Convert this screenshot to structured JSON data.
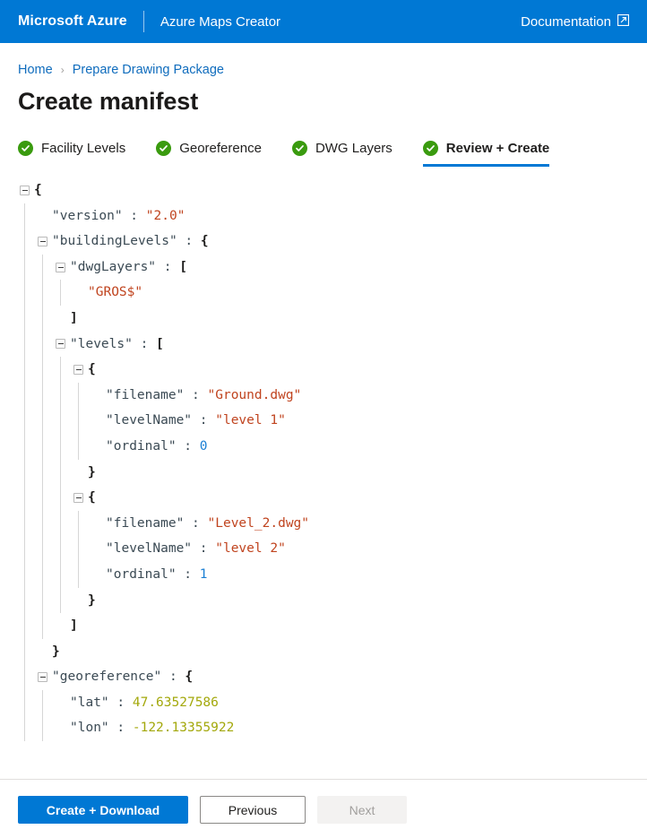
{
  "header": {
    "brand": "Microsoft Azure",
    "app_name": "Azure Maps Creator",
    "documentation_label": "Documentation",
    "external_link_icon": "external-link-icon",
    "background_color": "#0078d4"
  },
  "breadcrumb": {
    "items": [
      {
        "label": "Home"
      },
      {
        "label": "Prepare Drawing Package"
      }
    ],
    "separator": "›",
    "link_color": "#0f6cbd"
  },
  "page": {
    "title": "Create manifest"
  },
  "steps": {
    "items": [
      {
        "label": "Facility Levels",
        "completed": true,
        "active": false
      },
      {
        "label": "Georeference",
        "completed": true,
        "active": false
      },
      {
        "label": "DWG Layers",
        "completed": true,
        "active": false
      },
      {
        "label": "Review + Create",
        "completed": true,
        "active": true
      }
    ],
    "check_icon": "check-circle-icon",
    "check_color": "#3a9b0f",
    "active_underline_color": "#0078d4"
  },
  "manifest": {
    "lines": [
      {
        "indent": 0,
        "toggle": true,
        "tokens": [
          {
            "t": "brace",
            "v": "{"
          }
        ]
      },
      {
        "indent": 1,
        "toggle": false,
        "tokens": [
          {
            "t": "key",
            "v": "\"version\""
          },
          {
            "t": "punct",
            "v": " : "
          },
          {
            "t": "string",
            "v": "\"2.0\""
          }
        ]
      },
      {
        "indent": 1,
        "toggle": true,
        "tokens": [
          {
            "t": "key",
            "v": "\"buildingLevels\""
          },
          {
            "t": "punct",
            "v": " : "
          },
          {
            "t": "brace",
            "v": "{"
          }
        ]
      },
      {
        "indent": 2,
        "toggle": true,
        "tokens": [
          {
            "t": "key",
            "v": "\"dwgLayers\""
          },
          {
            "t": "punct",
            "v": " : "
          },
          {
            "t": "brace",
            "v": "["
          }
        ]
      },
      {
        "indent": 3,
        "toggle": false,
        "tokens": [
          {
            "t": "string",
            "v": "\"GROS$\""
          }
        ]
      },
      {
        "indent": 2,
        "toggle": false,
        "tokens": [
          {
            "t": "brace",
            "v": "]"
          }
        ]
      },
      {
        "indent": 2,
        "toggle": true,
        "tokens": [
          {
            "t": "key",
            "v": "\"levels\""
          },
          {
            "t": "punct",
            "v": " : "
          },
          {
            "t": "brace",
            "v": "["
          }
        ]
      },
      {
        "indent": 3,
        "toggle": true,
        "tokens": [
          {
            "t": "brace",
            "v": "{"
          }
        ]
      },
      {
        "indent": 4,
        "toggle": false,
        "tokens": [
          {
            "t": "key",
            "v": "\"filename\""
          },
          {
            "t": "punct",
            "v": " : "
          },
          {
            "t": "string",
            "v": "\"Ground.dwg\""
          }
        ]
      },
      {
        "indent": 4,
        "toggle": false,
        "tokens": [
          {
            "t": "key",
            "v": "\"levelName\""
          },
          {
            "t": "punct",
            "v": " : "
          },
          {
            "t": "string",
            "v": "\"level 1\""
          }
        ]
      },
      {
        "indent": 4,
        "toggle": false,
        "tokens": [
          {
            "t": "key",
            "v": "\"ordinal\""
          },
          {
            "t": "punct",
            "v": " : "
          },
          {
            "t": "number",
            "v": "0"
          }
        ]
      },
      {
        "indent": 3,
        "toggle": false,
        "tokens": [
          {
            "t": "brace",
            "v": "}"
          }
        ]
      },
      {
        "indent": 3,
        "toggle": true,
        "tokens": [
          {
            "t": "brace",
            "v": "{"
          }
        ]
      },
      {
        "indent": 4,
        "toggle": false,
        "tokens": [
          {
            "t": "key",
            "v": "\"filename\""
          },
          {
            "t": "punct",
            "v": " : "
          },
          {
            "t": "string",
            "v": "\"Level_2.dwg\""
          }
        ]
      },
      {
        "indent": 4,
        "toggle": false,
        "tokens": [
          {
            "t": "key",
            "v": "\"levelName\""
          },
          {
            "t": "punct",
            "v": " : "
          },
          {
            "t": "string",
            "v": "\"level 2\""
          }
        ]
      },
      {
        "indent": 4,
        "toggle": false,
        "tokens": [
          {
            "t": "key",
            "v": "\"ordinal\""
          },
          {
            "t": "punct",
            "v": " : "
          },
          {
            "t": "number",
            "v": "1"
          }
        ]
      },
      {
        "indent": 3,
        "toggle": false,
        "tokens": [
          {
            "t": "brace",
            "v": "}"
          }
        ]
      },
      {
        "indent": 2,
        "toggle": false,
        "tokens": [
          {
            "t": "brace",
            "v": "]"
          }
        ]
      },
      {
        "indent": 1,
        "toggle": false,
        "tokens": [
          {
            "t": "brace",
            "v": "}"
          }
        ]
      },
      {
        "indent": 1,
        "toggle": true,
        "tokens": [
          {
            "t": "key",
            "v": "\"georeference\""
          },
          {
            "t": "punct",
            "v": " : "
          },
          {
            "t": "brace",
            "v": "{"
          }
        ]
      },
      {
        "indent": 2,
        "toggle": false,
        "tokens": [
          {
            "t": "key",
            "v": "\"lat\""
          },
          {
            "t": "punct",
            "v": " : "
          },
          {
            "t": "float",
            "v": "47.63527586"
          }
        ]
      },
      {
        "indent": 2,
        "toggle": false,
        "tokens": [
          {
            "t": "key",
            "v": "\"lon\""
          },
          {
            "t": "punct",
            "v": " : "
          },
          {
            "t": "float",
            "v": "-122.13355922"
          }
        ]
      }
    ],
    "colors": {
      "key": "#3b4a54",
      "string": "#c0441f",
      "number": "#1a7fd4",
      "float": "#a3a80b",
      "brace": "#1b1a19"
    }
  },
  "footer": {
    "buttons": [
      {
        "label": "Create + Download",
        "style": "primary",
        "disabled": false
      },
      {
        "label": "Previous",
        "style": "secondary",
        "disabled": false
      },
      {
        "label": "Next",
        "style": "disabled",
        "disabled": true
      }
    ]
  }
}
